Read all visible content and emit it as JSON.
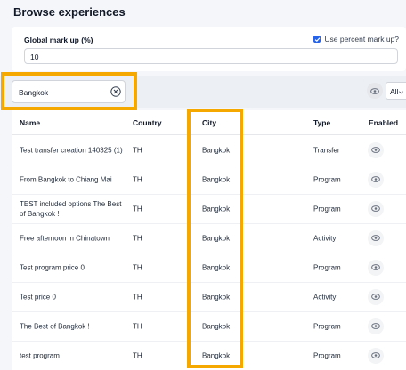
{
  "page": {
    "title": "Browse experiences"
  },
  "markup": {
    "label": "Global mark up (%)",
    "value": "10",
    "percent_checkbox_label": "Use percent mark up?",
    "percent_checked": true
  },
  "filter": {
    "search_value": "Bangkok",
    "select_value": "All"
  },
  "table": {
    "headers": {
      "name": "Name",
      "country": "Country",
      "city": "City",
      "type": "Type",
      "enabled": "Enabled"
    },
    "rows": [
      {
        "name": "Test transfer creation 140325 (1)",
        "country": "TH",
        "city": "Bangkok",
        "type": "Transfer"
      },
      {
        "name": "From Bangkok to Chiang Mai",
        "country": "TH",
        "city": "Bangkok",
        "type": "Program"
      },
      {
        "name": "TEST included options The Best of Bangkok !",
        "country": "TH",
        "city": "Bangkok",
        "type": "Program"
      },
      {
        "name": "Free afternoon in Chinatown",
        "country": "TH",
        "city": "Bangkok",
        "type": "Activity"
      },
      {
        "name": "Test program price 0",
        "country": "TH",
        "city": "Bangkok",
        "type": "Program"
      },
      {
        "name": "Test price 0",
        "country": "TH",
        "city": "Bangkok",
        "type": "Activity"
      },
      {
        "name": "The Best of Bangkok !",
        "country": "TH",
        "city": "Bangkok",
        "type": "Program"
      },
      {
        "name": "test program",
        "country": "TH",
        "city": "Bangkok",
        "type": "Program"
      }
    ]
  },
  "colors": {
    "highlight": "#f5a900",
    "accent": "#2563eb"
  },
  "icons": {
    "clear": "clear-circle-x-icon",
    "view": "eye-icon",
    "checkbox": "check-icon",
    "dropdown": "chevron-down-icon"
  }
}
